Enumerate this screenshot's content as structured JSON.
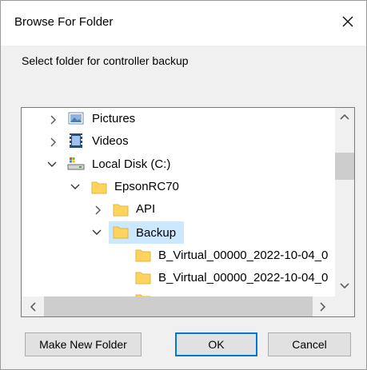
{
  "dialog": {
    "title": "Browse For Folder",
    "prompt": "Select folder for controller backup"
  },
  "tree": {
    "items": [
      {
        "label": "Pictures",
        "icon": "pictures-folder-icon",
        "expander": "collapsed"
      },
      {
        "label": "Videos",
        "icon": "videos-folder-icon",
        "expander": "collapsed"
      },
      {
        "label": "Local Disk (C:)",
        "icon": "drive-icon",
        "expander": "expanded"
      },
      {
        "label": "EpsonRC70",
        "icon": "folder-icon",
        "expander": "expanded"
      },
      {
        "label": "API",
        "icon": "folder-icon",
        "expander": "collapsed"
      },
      {
        "label": "Backup",
        "icon": "folder-icon",
        "expander": "expanded",
        "selected": true
      },
      {
        "label": "B_Virtual_00000_2022-10-04_0",
        "icon": "folder-icon",
        "expander": "none"
      },
      {
        "label": "B_Virtual_00000_2022-10-04_0",
        "icon": "folder-icon",
        "expander": "none"
      }
    ]
  },
  "buttons": {
    "new_folder": "Make New Folder",
    "ok": "OK",
    "cancel": "Cancel"
  },
  "colors": {
    "selection": "#cce8ff",
    "folder": "#ffd35c",
    "default_border": "#0078d7"
  }
}
